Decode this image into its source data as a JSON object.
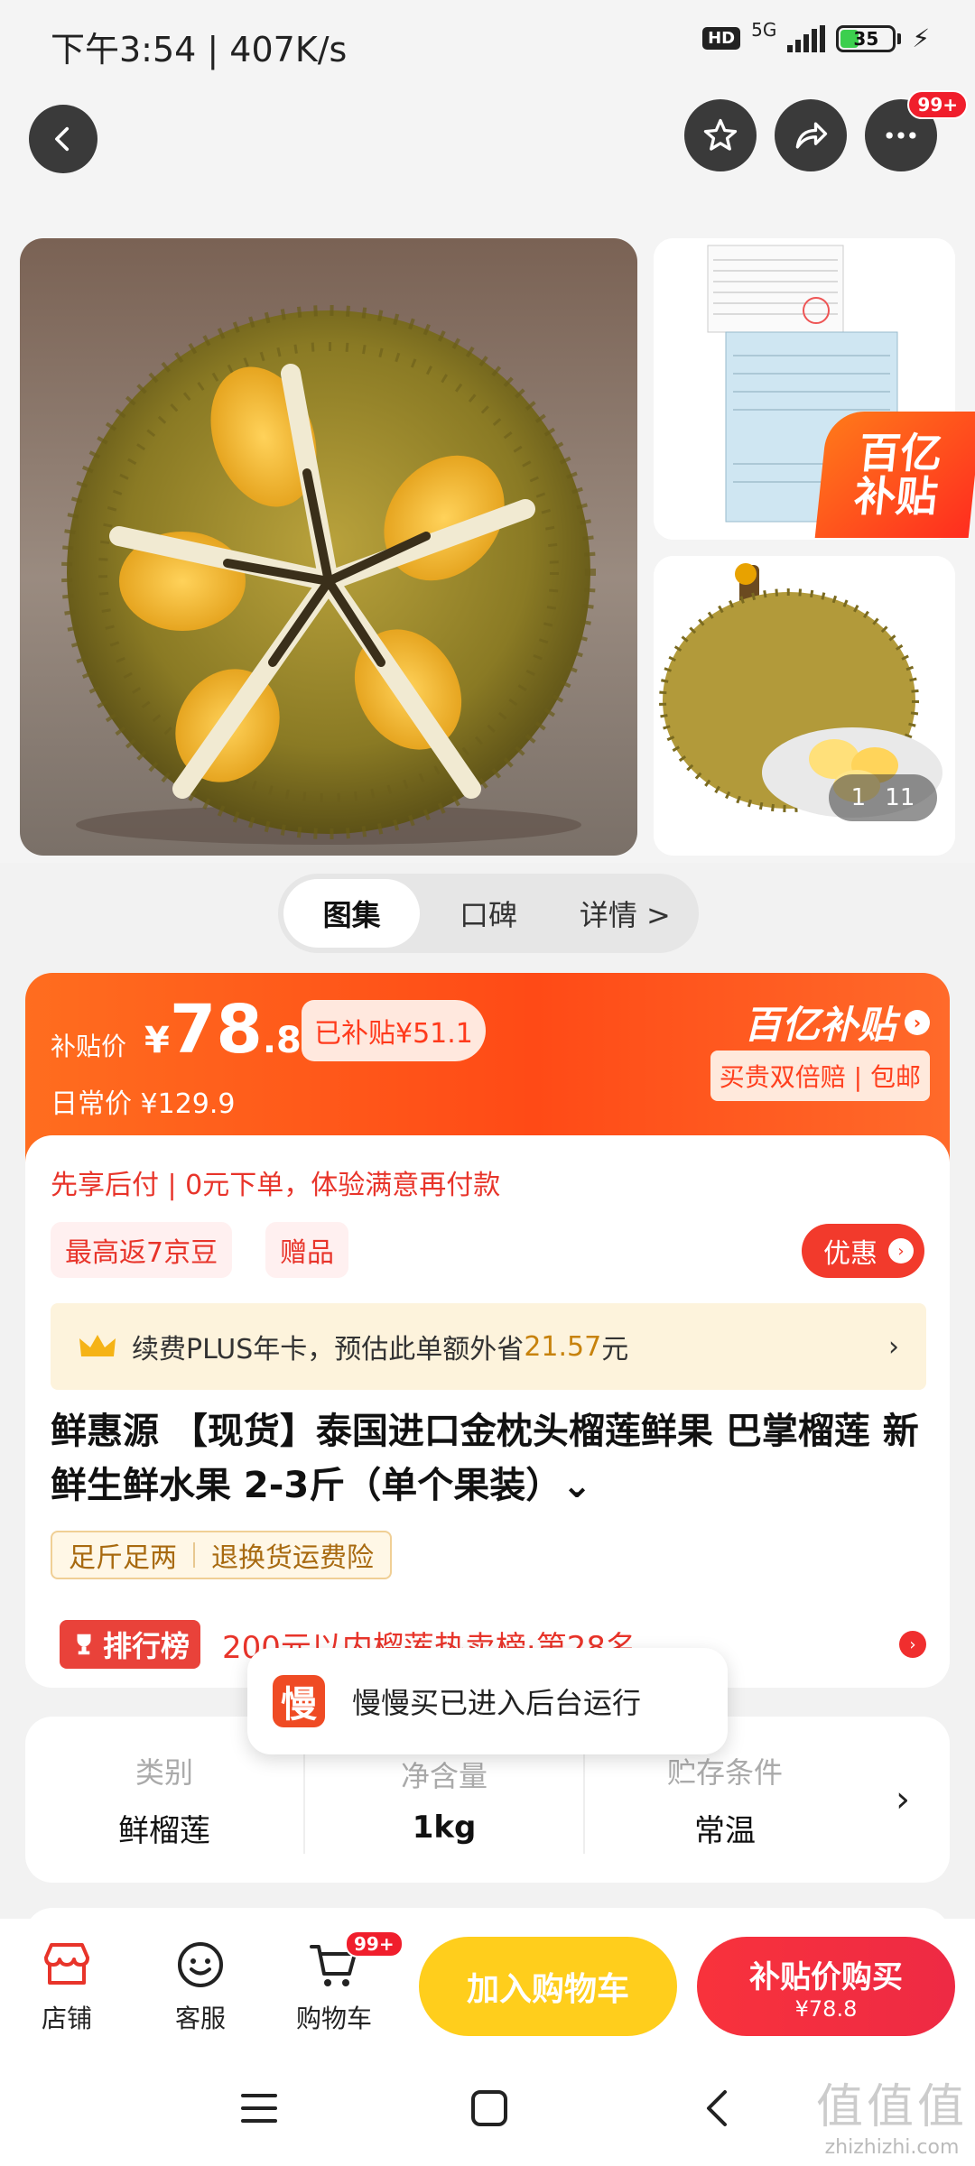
{
  "status_bar": {
    "time_speed": "下午3:54 | 407K/s",
    "hd": "HD",
    "network": "5G",
    "battery": "35",
    "battery_level": 0.35
  },
  "top_nav": {
    "more_badge": "99+"
  },
  "gallery": {
    "subsidy_corner_line1": "百亿",
    "subsidy_corner_line2": "补贴",
    "counter_current": "1",
    "counter_total": "11"
  },
  "tabs": [
    {
      "label": "图集"
    },
    {
      "label": "口碑"
    },
    {
      "label": "详情 >"
    }
  ],
  "price": {
    "label": "补贴价",
    "yen": "¥",
    "integer": "78",
    "decimal": ".8",
    "subsidized": "已补贴¥51.1",
    "daily": "日常价 ¥129.9",
    "brand": "百亿补贴",
    "guarantee": "买贵双倍赔 | 包邮"
  },
  "info": {
    "pay_later": "先享后付 | 0元下单，体验满意再付款",
    "tags": [
      "最高返7京豆",
      "赠品"
    ],
    "promo_button": "优惠",
    "plus_text": "续费PLUS年卡，预估此单额外省",
    "plus_amount": "21.57",
    "plus_unit": "元",
    "title": "鲜惠源 【现货】泰国进口金枕头榴莲鲜果 巴掌榴莲  新鲜生鲜水果 2-3斤（单个果装）⌄",
    "features": [
      "足斤足两",
      "退换货运费险"
    ],
    "rank_badge": "排行榜",
    "rank_text": "200元以内榴莲热卖榜·第28名"
  },
  "toast": {
    "logo": "慢",
    "text": "慢慢买已进入后台运行"
  },
  "specs": [
    {
      "label": "类别",
      "value": "鲜榴莲"
    },
    {
      "label": "净含量",
      "value": "1kg"
    },
    {
      "label": "贮存条件",
      "value": "常温"
    }
  ],
  "bottom_bar": {
    "store": "店铺",
    "service": "客服",
    "cart": "购物车",
    "cart_badge": "99+",
    "add_to_cart": "加入购物车",
    "buy_line1": "补贴价购买",
    "buy_line2": "¥78.8"
  },
  "watermark": {
    "line1": "值值值",
    "line2": "zhizhizhi.com"
  },
  "colors": {
    "accent_red": "#f23a2c",
    "accent_orange": "#ff5a1a",
    "accent_yellow": "#ffce1c"
  }
}
